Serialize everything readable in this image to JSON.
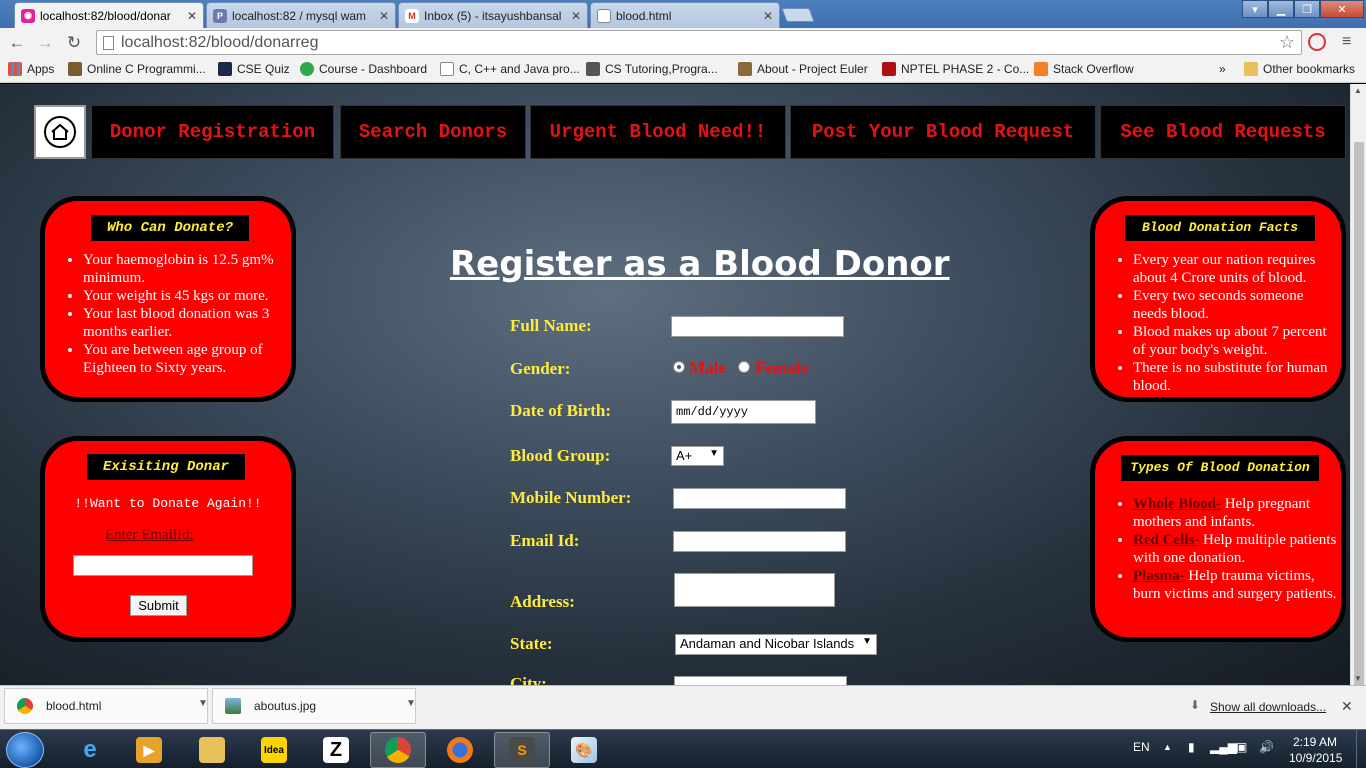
{
  "browser": {
    "tabs": [
      {
        "title": "localhost:82/blood/donar",
        "icon_color": "#e0249a",
        "active": true
      },
      {
        "title": "localhost:82 / mysql wam",
        "icon_color": "#6c7ab0",
        "active": false
      },
      {
        "title": "Inbox (5) - itsayushbansal",
        "icon_color": "#d93025",
        "active": false
      },
      {
        "title": "blood.html",
        "icon_color": "#ffffff",
        "active": false
      }
    ],
    "url": "localhost:82/blood/donarreg",
    "bookmarks": [
      {
        "label": "Apps",
        "icon_color": "#e74c3c"
      },
      {
        "label": "Online C Programmi...",
        "icon_color": "#7a5c2e"
      },
      {
        "label": "CSE Quiz",
        "icon_color": "#1a2a4a"
      },
      {
        "label": "Course - Dashboard",
        "icon_color": "#2ea84a"
      },
      {
        "label": "C, C++ and Java pro...",
        "icon_color": "#ffffff"
      },
      {
        "label": "CS Tutoring,Progra...",
        "icon_color": "#555555"
      },
      {
        "label": "About - Project Euler",
        "icon_color": "#8a6a3a"
      },
      {
        "label": "NPTEL PHASE 2 - Co...",
        "icon_color": "#b01010"
      },
      {
        "label": "Stack Overflow",
        "icon_color": "#f48024"
      }
    ],
    "bookmarks_overflow": "»",
    "other_bookmarks": "Other bookmarks"
  },
  "site": {
    "nav": [
      "Donor Registration",
      "Search Donors",
      "Urgent Blood Need!!",
      "Post Your Blood Request",
      "See Blood Requests"
    ],
    "left_panels": {
      "who_can_donate": {
        "title": "Who Can Donate?",
        "items": [
          "Your haemoglobin is 12.5 gm% minimum.",
          "Your weight is 45 kgs or more.",
          "Your last blood donation was 3 months earlier.",
          "You are between age group of Eighteen to Sixty years."
        ]
      },
      "existing_donor": {
        "title": "Exisiting Donar",
        "subtitle": "!!Want to Donate Again!!",
        "email_label": "Enter EmailId:",
        "email_value": "",
        "submit_label": "Submit"
      }
    },
    "right_panels": {
      "facts": {
        "title": "Blood Donation Facts",
        "items": [
          "Every year our nation requires about 4 Crore units of blood.",
          "Every two seconds someone needs blood.",
          "Blood makes up about 7 percent of your body's weight.",
          "There is no substitute for human blood."
        ]
      },
      "types": {
        "title": "Types Of Blood Donation",
        "items": [
          {
            "term": "Whole Blood-",
            "desc": " Help pregnant mothers and infants."
          },
          {
            "term": "Red Cells-",
            "desc": " Help multiple patients with one donation."
          },
          {
            "term": "Plasma-",
            "desc": " Help trauma victims, burn victims and surgery patients."
          }
        ]
      }
    },
    "form": {
      "title": "Register as a Blood Donor",
      "full_name_label": "Full Name:",
      "full_name_value": "",
      "gender_label": "Gender:",
      "gender_options": [
        "Male",
        "Female"
      ],
      "gender_selected": "Male",
      "dob_label": "Date of Birth:",
      "dob_placeholder": "mm/dd/yyyy",
      "blood_group_label": "Blood Group:",
      "blood_group_value": "A+",
      "mobile_label": "Mobile Number:",
      "mobile_value": "",
      "email_label": "Email Id:",
      "email_value": "",
      "address_label": "Address:",
      "address_value": "",
      "state_label": "State:",
      "state_value": "Andaman and Nicobar Islands",
      "city_label": "City:"
    }
  },
  "downloads": {
    "items": [
      "blood.html",
      "aboutus.jpg"
    ],
    "show_all": "Show all downloads..."
  },
  "taskbar": {
    "language": "EN",
    "time": "2:19 AM",
    "date": "10/9/2015"
  }
}
